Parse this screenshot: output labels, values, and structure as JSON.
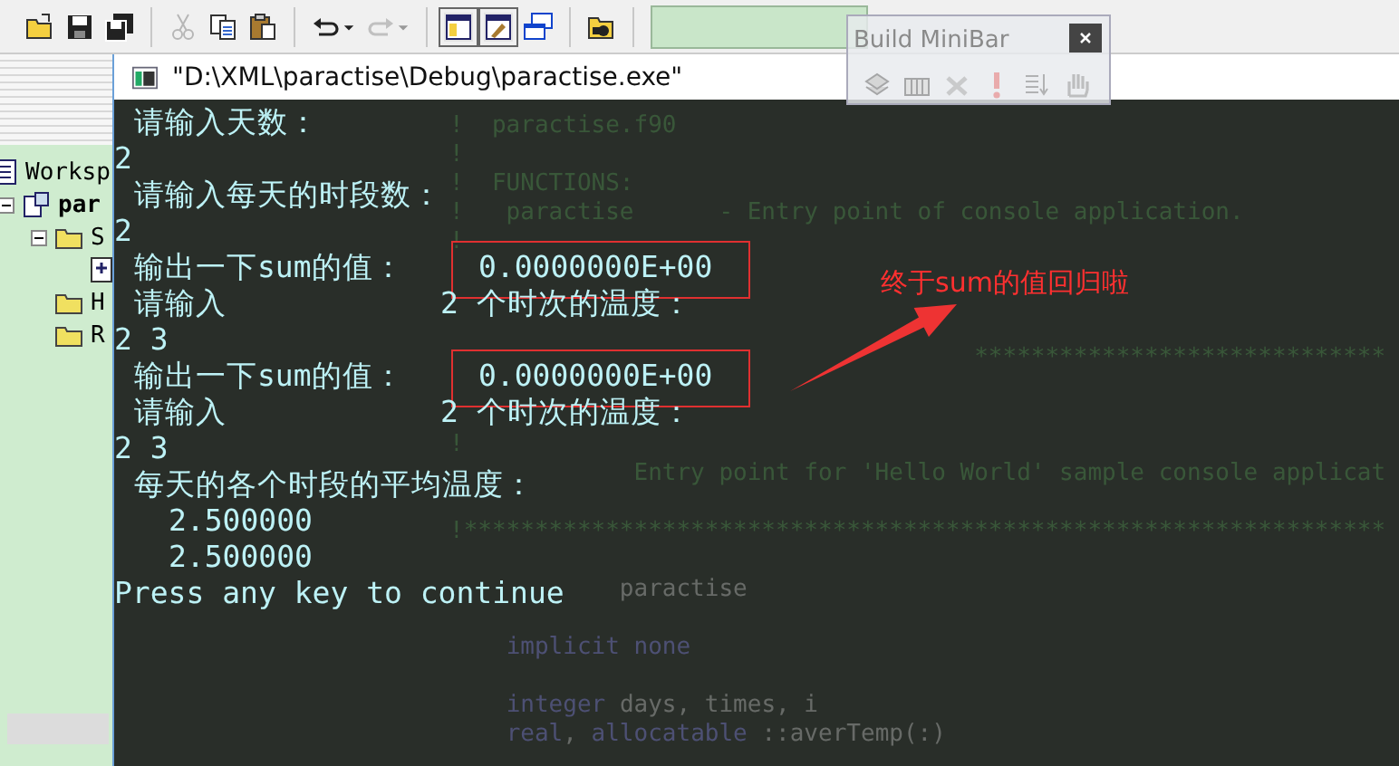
{
  "toolbar": {
    "groups": [
      [
        {
          "kind": "open",
          "disabled": false,
          "pressed": false,
          "dropdown": false
        },
        {
          "kind": "save",
          "disabled": false,
          "pressed": false,
          "dropdown": false
        },
        {
          "kind": "save-all",
          "disabled": false,
          "pressed": false,
          "dropdown": false
        }
      ],
      [
        {
          "kind": "cut",
          "disabled": true,
          "pressed": false,
          "dropdown": false
        },
        {
          "kind": "copy",
          "disabled": false,
          "pressed": false,
          "dropdown": false
        },
        {
          "kind": "paste",
          "disabled": false,
          "pressed": false,
          "dropdown": false
        }
      ],
      [
        {
          "kind": "undo",
          "disabled": false,
          "pressed": false,
          "dropdown": true
        },
        {
          "kind": "redo",
          "disabled": true,
          "pressed": false,
          "dropdown": true
        }
      ],
      [
        {
          "kind": "workspace-window",
          "disabled": false,
          "pressed": true,
          "dropdown": false
        },
        {
          "kind": "output-window",
          "disabled": false,
          "pressed": true,
          "dropdown": false
        },
        {
          "kind": "window-list",
          "disabled": false,
          "pressed": false,
          "dropdown": false
        }
      ],
      [
        {
          "kind": "find",
          "disabled": false,
          "pressed": false,
          "dropdown": false
        }
      ]
    ]
  },
  "minibar": {
    "title": "Build MiniBar",
    "buttons": [
      {
        "kind": "compile"
      },
      {
        "kind": "build"
      },
      {
        "kind": "stop"
      },
      {
        "kind": "execute"
      },
      {
        "kind": "breakpoint"
      },
      {
        "kind": "hand"
      }
    ]
  },
  "workspace": {
    "tree": [
      {
        "label": "Worksp",
        "kind": "workspace",
        "children": [
          {
            "label": "par",
            "kind": "project",
            "expanded": true,
            "children": [
              {
                "label": "S",
                "kind": "folder",
                "expanded": true,
                "children": [
                  {
                    "kind": "file"
                  }
                ]
              },
              {
                "label": "H",
                "kind": "folder"
              },
              {
                "label": "R",
                "kind": "folder"
              }
            ]
          }
        ]
      }
    ]
  },
  "editor": {
    "lines": [
      {
        "kind": "comment",
        "text": "!  paractise.f90"
      },
      {
        "kind": "comment",
        "text": "!"
      },
      {
        "kind": "comment",
        "text": "!  FUNCTIONS:"
      },
      {
        "kind": "comment",
        "text": "!   paractise      - Entry point of console application."
      },
      {
        "kind": "comment",
        "text": "!"
      },
      {
        "kind": "blank"
      },
      {
        "kind": "blank"
      },
      {
        "kind": "blank"
      },
      {
        "kind": "comment",
        "text": "                                     *****************************"
      },
      {
        "kind": "blank"
      },
      {
        "kind": "blank"
      },
      {
        "kind": "comment",
        "text": "!"
      },
      {
        "kind": "comment",
        "text": "             Entry point for 'Hello World' sample console applicat"
      },
      {
        "kind": "blank"
      },
      {
        "kind": "comment",
        "text": "!*****************************************************************"
      },
      {
        "kind": "blank"
      },
      {
        "kind": "code",
        "tokens": [
          {
            "kind": "plain",
            "text": "            paractise"
          }
        ]
      },
      {
        "kind": "blank"
      },
      {
        "kind": "code",
        "tokens": [
          {
            "kind": "keyword",
            "text": "    implicit none"
          }
        ]
      },
      {
        "kind": "blank"
      },
      {
        "kind": "code",
        "tokens": [
          {
            "kind": "keyword",
            "text": "    integer"
          },
          {
            "kind": "plain",
            "text": " days, times, i"
          }
        ]
      },
      {
        "kind": "code",
        "tokens": [
          {
            "kind": "keyword",
            "text": "    real"
          },
          {
            "kind": "plain",
            "text": ", "
          },
          {
            "kind": "keyword",
            "text": "allocatable"
          },
          {
            "kind": "plain",
            "text": " ::averTemp(:)"
          }
        ]
      }
    ]
  },
  "console": {
    "title": "\"D:\\XML\\paractise\\Debug\\paractise.exe\"",
    "rows": [
      {
        "kind": "text",
        "text": "请输入天数："
      },
      {
        "kind": "input",
        "text": "2"
      },
      {
        "kind": "text",
        "text": "请输入每天的时段数："
      },
      {
        "kind": "input",
        "text": "2"
      },
      {
        "kind": "sum",
        "label": "输出一下sum的值：",
        "value": "0.0000000E+00",
        "highlighted": true
      },
      {
        "kind": "prompt",
        "label": "请输入",
        "value": "2 个时次的温度："
      },
      {
        "kind": "input",
        "text": "2 3"
      },
      {
        "kind": "sum",
        "label": "输出一下sum的值：",
        "value": "0.0000000E+00",
        "highlighted": true
      },
      {
        "kind": "prompt",
        "label": "请输入",
        "value": "2 个时次的温度："
      },
      {
        "kind": "input",
        "text": "2 3"
      },
      {
        "kind": "text",
        "text": "每天的各个时段的平均温度："
      },
      {
        "kind": "number",
        "text": "2.500000"
      },
      {
        "kind": "number",
        "text": "2.500000"
      },
      {
        "kind": "input",
        "text": "Press any key to continue"
      }
    ],
    "annotation": {
      "text": "终于sum的值回归啦"
    }
  }
}
